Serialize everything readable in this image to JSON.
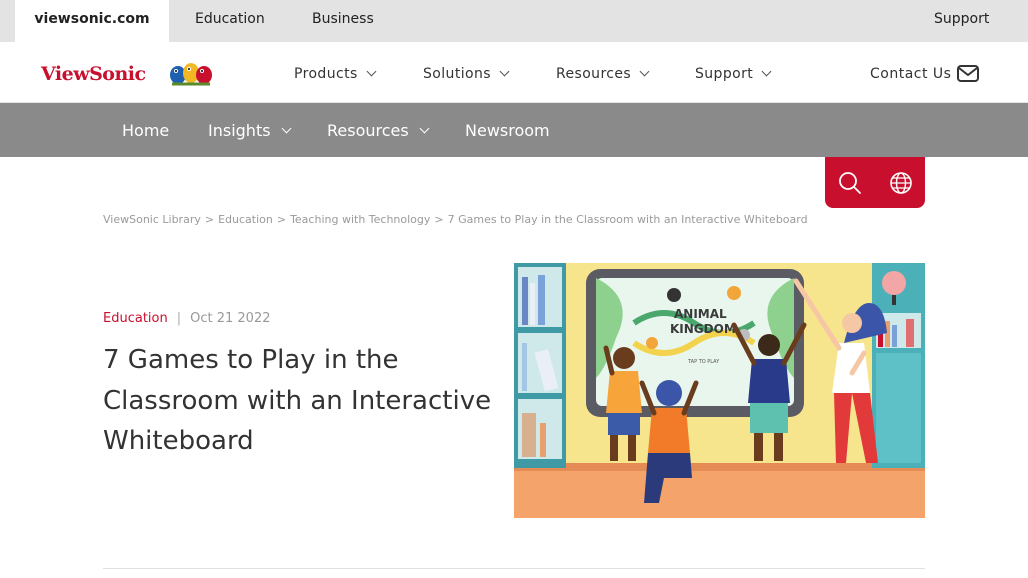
{
  "topbar": {
    "tabs": [
      {
        "label": "viewsonic.com"
      },
      {
        "label": "Education"
      },
      {
        "label": "Business"
      }
    ],
    "support_label": "Support"
  },
  "header": {
    "logo_text": "ViewSonic",
    "nav": [
      {
        "label": "Products"
      },
      {
        "label": "Solutions"
      },
      {
        "label": "Resources"
      },
      {
        "label": "Support"
      }
    ],
    "contact_label": "Contact Us"
  },
  "subnav": {
    "items": [
      {
        "label": "Home"
      },
      {
        "label": "Insights"
      },
      {
        "label": "Resources"
      },
      {
        "label": "Newsroom"
      }
    ]
  },
  "toolbox": {
    "accent": "#c8102e",
    "search_icon": "search-icon",
    "globe_icon": "globe-icon"
  },
  "breadcrumb": {
    "items": [
      "ViewSonic Library",
      "Education",
      "Teaching with Technology",
      "7 Games to Play in the Classroom with an Interactive Whiteboard"
    ],
    "separator": ">"
  },
  "article": {
    "category": "Education",
    "date": "Oct 21 2022",
    "title": "7 Games to Play in the Classroom with an Interactive Whiteboard",
    "hero_board_title_1": "ANIMAL",
    "hero_board_title_2": "KINGDOM",
    "hero_board_button": "TAP TO PLAY"
  }
}
